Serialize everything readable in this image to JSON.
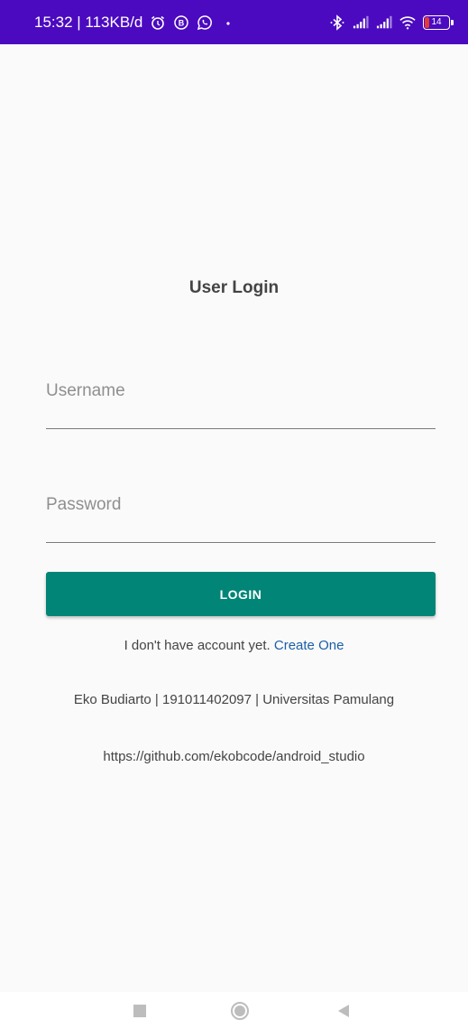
{
  "status_bar": {
    "time_info": "15:32 | 113KB/d",
    "left_icons": [
      "alarm-icon",
      "b-circle-icon",
      "whatsapp-icon",
      "dot-icon"
    ],
    "right_icons": [
      "bluetooth-icon",
      "signal-icon",
      "signal-icon",
      "wifi-icon"
    ],
    "battery_level": "14",
    "color": "#4b0ac0"
  },
  "login": {
    "title": "User Login",
    "username_placeholder": "Username",
    "password_placeholder": "Password",
    "login_button": "LOGIN",
    "signup_prompt": "I don't have account yet.",
    "signup_link": "Create One",
    "credit": "Eko Budiarto | 191011402097 | Universitas Pamulang",
    "repo": "https://github.com/ekobcode/android_studio",
    "accent_color": "#008577",
    "link_color": "#1a5fa8"
  },
  "nav_bar": {
    "buttons": [
      "recents-icon",
      "home-icon",
      "back-icon"
    ]
  }
}
